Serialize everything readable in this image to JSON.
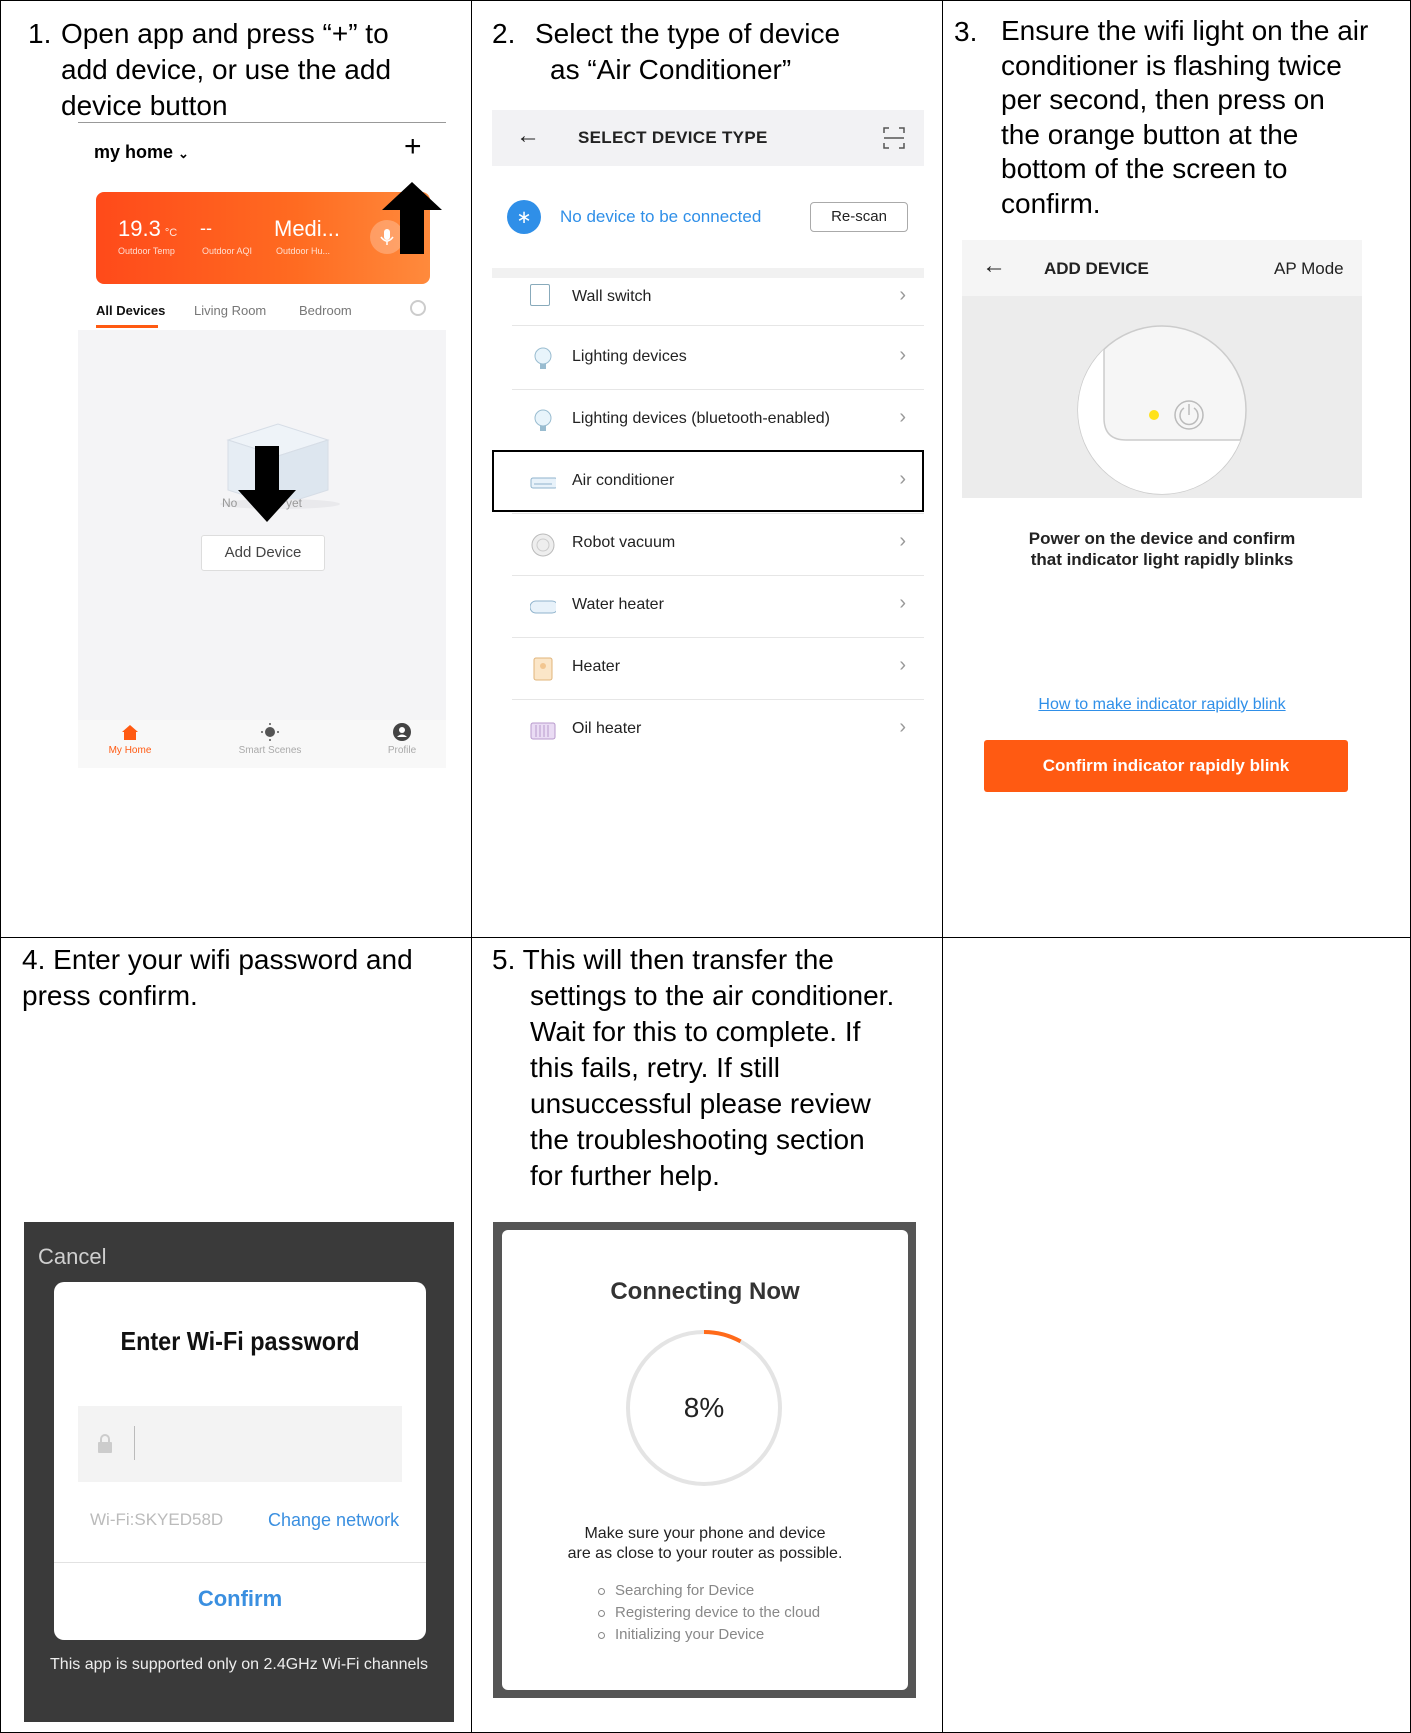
{
  "steps": [
    {
      "num": "1.",
      "lines": [
        "Open app and press “+” to",
        "add device, or use the add",
        "device button"
      ]
    },
    {
      "num": "2.",
      "lines": [
        "Select the type of device",
        "as  “Air Conditioner”"
      ]
    },
    {
      "num": "3.",
      "lines": [
        "Ensure the wifi light on the air",
        "conditioner is flashing twice",
        "per second,  then press on",
        "the orange button at the",
        "bottom of the screen to",
        "confirm."
      ]
    },
    {
      "num": "4.",
      "lines": [
        "Enter your wifi password and",
        "press confirm."
      ]
    },
    {
      "num": "5.",
      "lines": [
        "This will then transfer the",
        "settings to the air conditioner.",
        "Wait for this to complete. If",
        "this fails, retry. If still",
        "unsuccessful please review",
        "the troubleshooting section",
        "for further help."
      ]
    }
  ],
  "panel1": {
    "home_label": "my home",
    "plus": "+",
    "weather": {
      "temp": "19.3",
      "temp_unit": "°C",
      "aqi": "--",
      "humidity": "Medi...",
      "temp_label": "Outdoor Temp",
      "aqi_label": "Outdoor AQI",
      "hum_label": "Outdoor Hu..."
    },
    "tabs": [
      "All Devices",
      "Living Room",
      "Bedroom"
    ],
    "empty_text_left": "No",
    "empty_text_right": "yet",
    "add_device": "Add Device",
    "nav": [
      "My Home",
      "Smart Scenes",
      "Profile"
    ],
    "accent": "#ff5a12"
  },
  "panel2": {
    "header": "SELECT DEVICE TYPE",
    "bt_message": "No device to be connected",
    "rescan": "Re-scan",
    "items": [
      "Wall switch",
      "Lighting devices",
      "Lighting devices (bluetooth-enabled)",
      "Air conditioner",
      "Robot vacuum",
      "Water heater",
      "Heater",
      "Oil heater"
    ],
    "selected": "Air conditioner",
    "link_color": "#2f8fe8"
  },
  "panel3": {
    "header": "ADD DEVICE",
    "mode": "AP Mode",
    "instruction_lines": [
      "Power on the device and confirm",
      "that indicator light rapidly blinks"
    ],
    "help_link": "How to make indicator rapidly blink",
    "confirm": "Confirm indicator rapidly blink"
  },
  "panel4": {
    "cancel": "Cancel",
    "title": "Enter Wi-Fi password",
    "wifi": "Wi-Fi:SKYED58D",
    "change_network": "Change network",
    "confirm": "Confirm",
    "footer": "This app is supported only on 2.4GHz Wi-Fi channels"
  },
  "panel5": {
    "title": "Connecting Now",
    "progress_text": "8%",
    "progress": 0.08,
    "message_lines": [
      "Make sure your phone and device",
      "are as close to your router as possible."
    ],
    "checklist": [
      "Searching for Device",
      "Registering device to the cloud",
      "Initializing your Device"
    ]
  }
}
